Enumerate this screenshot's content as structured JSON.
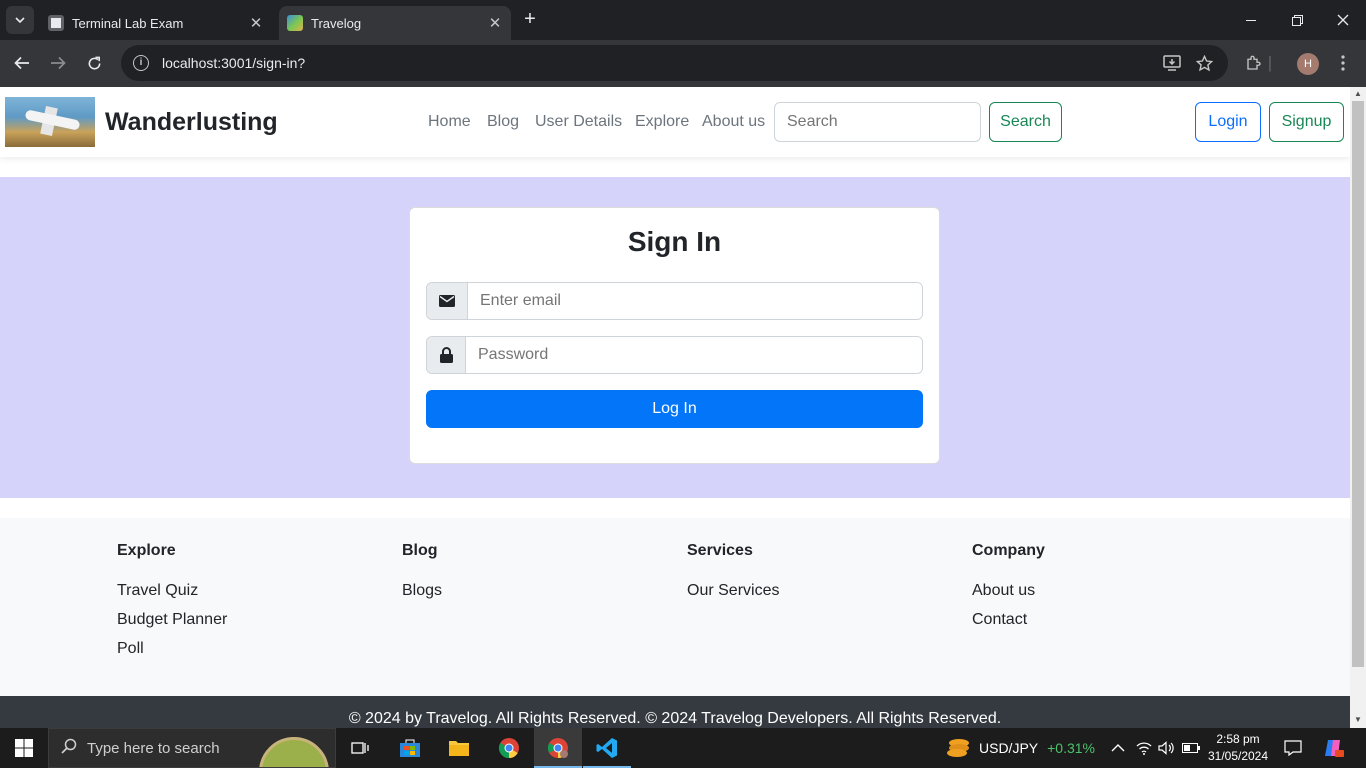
{
  "browser": {
    "tabs": [
      {
        "title": "Terminal Lab Exam",
        "active": false
      },
      {
        "title": "Travelog",
        "active": true
      }
    ],
    "url": "localhost:3001/sign-in?",
    "profile_initial": "H"
  },
  "navbar": {
    "brand": "Wanderlusting",
    "links": [
      "Home",
      "Blog",
      "User Details",
      "Explore",
      "About us"
    ],
    "search_placeholder": "Search",
    "search_button": "Search",
    "login_button": "Login",
    "signup_button": "Signup"
  },
  "signin": {
    "title": "Sign In",
    "email_placeholder": "Enter email",
    "password_placeholder": "Password",
    "submit_label": "Log In"
  },
  "footer": {
    "columns": [
      {
        "heading": "Explore",
        "links": [
          "Travel Quiz",
          "Budget Planner",
          "Poll"
        ]
      },
      {
        "heading": "Blog",
        "links": [
          "Blogs"
        ]
      },
      {
        "heading": "Services",
        "links": [
          "Our Services"
        ]
      },
      {
        "heading": "Company",
        "links": [
          "About us",
          "Contact"
        ]
      }
    ],
    "copyright": "© 2024 by Travelog. All Rights Reserved. © 2024 Travelog Developers. All Rights Reserved."
  },
  "taskbar": {
    "search_placeholder": "Type here to search",
    "ticker_symbol": "USD/JPY",
    "ticker_change": "+0.31%",
    "time": "2:58 pm",
    "date": "31/05/2024"
  },
  "colors": {
    "hero_bg": "#d5d3fa",
    "primary": "#0275f8",
    "success": "#198754",
    "footer_bg": "#f8f9fa",
    "copyright_bg": "#343a40"
  }
}
